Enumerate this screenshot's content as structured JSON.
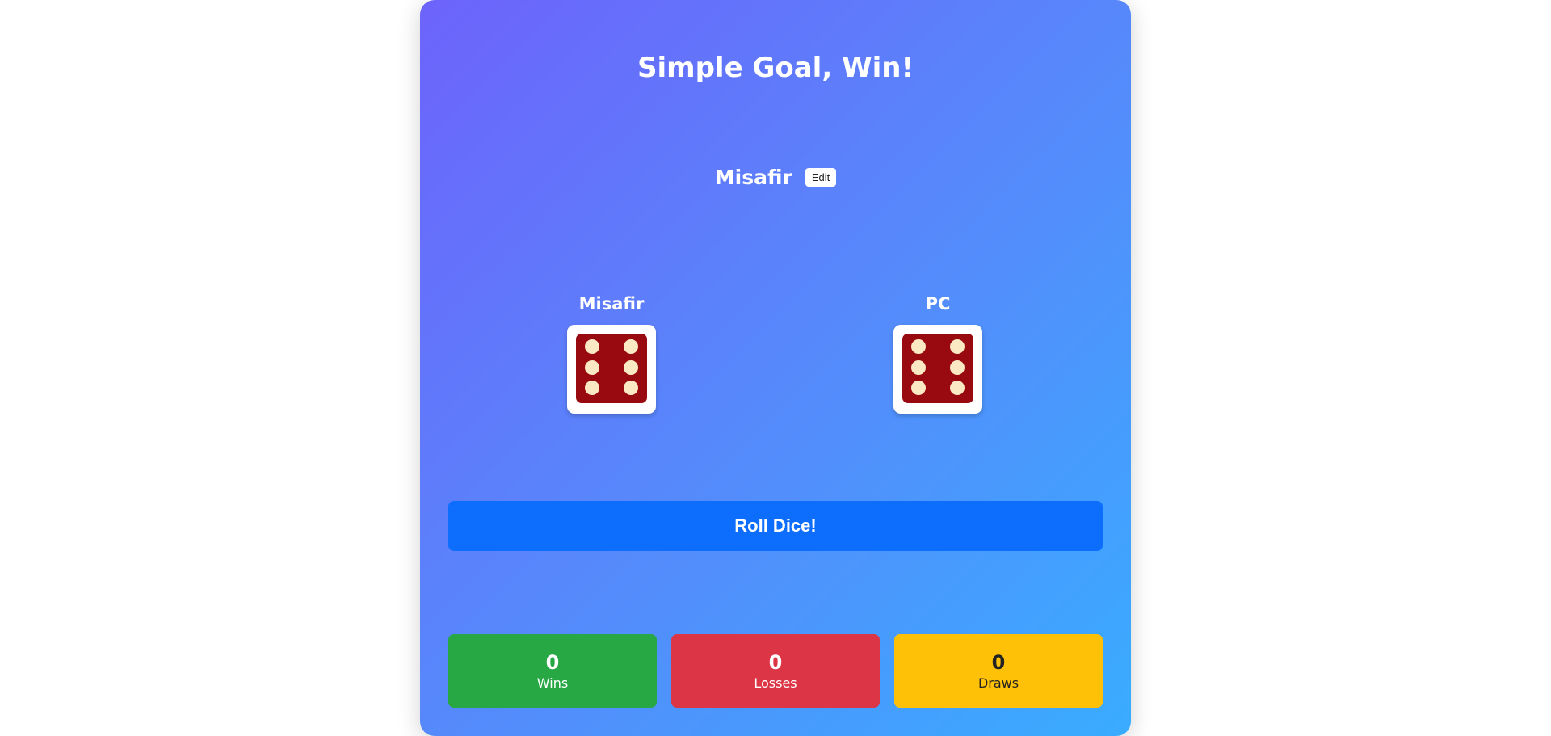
{
  "header": {
    "title": "Simple Goal, Win!"
  },
  "player": {
    "name": "Misafir",
    "edit_label": "Edit"
  },
  "board": {
    "player_label": "Misafir",
    "opponent_label": "PC",
    "player_die_value": 6,
    "opponent_die_value": 6
  },
  "roll_button": {
    "label": "Roll Dice!"
  },
  "stats": {
    "wins": {
      "value": "0",
      "label": "Wins"
    },
    "losses": {
      "value": "0",
      "label": "Losses"
    },
    "draws": {
      "value": "0",
      "label": "Draws"
    }
  },
  "colors": {
    "die_face": "#990a10",
    "die_pip": "#fbe9c3",
    "roll_button": "#0d6efd",
    "wins": "#28a745",
    "losses": "#dc3545",
    "draws": "#ffc107"
  }
}
